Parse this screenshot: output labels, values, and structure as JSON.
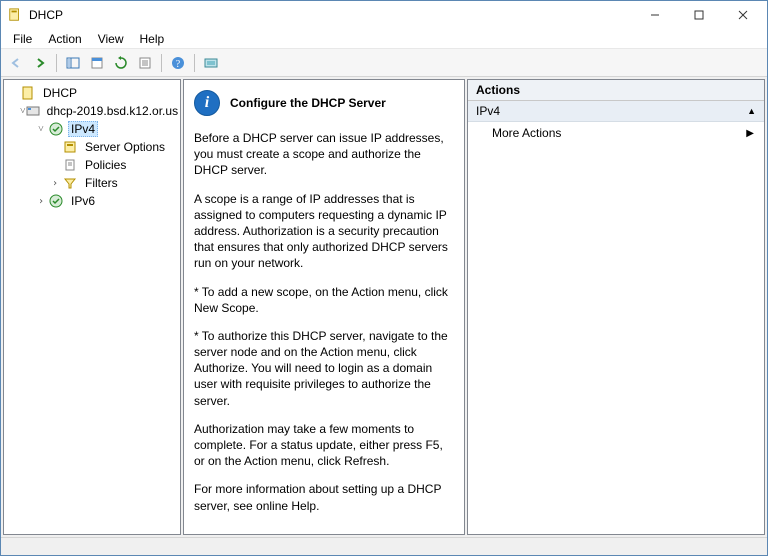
{
  "window": {
    "title": "DHCP"
  },
  "menu": {
    "file": "File",
    "action": "Action",
    "view": "View",
    "help": "Help"
  },
  "tree": {
    "root": "DHCP",
    "server": "dhcp-2019.bsd.k12.or.us",
    "ipv4": "IPv4",
    "serverOptions": "Server Options",
    "policies": "Policies",
    "filters": "Filters",
    "ipv6": "IPv6"
  },
  "center": {
    "title": "Configure the DHCP Server",
    "p1": "Before a DHCP server can issue IP addresses, you must create a scope and authorize the DHCP server.",
    "p2": "A scope is a range of IP addresses that is assigned to computers requesting a dynamic IP address. Authorization is a security precaution that ensures that only authorized DHCP servers run on your network.",
    "p3": "* To add a new scope, on the Action menu, click New Scope.",
    "p4": "* To authorize this DHCP server, navigate to the server node and on the Action menu, click Authorize. You will need to login as a domain user with requisite privileges to authorize the server.",
    "p5": "Authorization may take a few moments to complete. For a status update, either press F5, or on the Action menu, click Refresh.",
    "p6": "For more information about setting up a DHCP server, see online Help."
  },
  "actions": {
    "header": "Actions",
    "section": "IPv4",
    "moreActions": "More Actions"
  }
}
